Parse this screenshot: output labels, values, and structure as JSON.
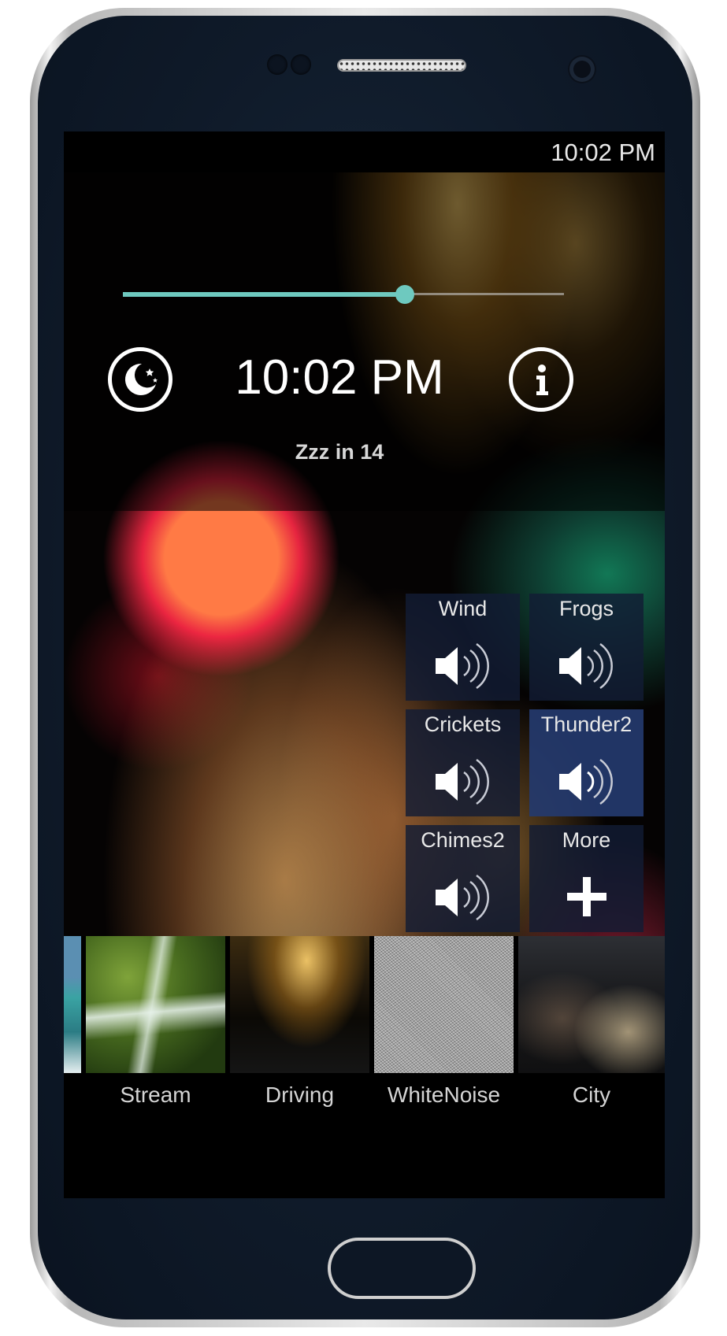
{
  "status_bar": {
    "time": "10:02 PM"
  },
  "player": {
    "volume_level": 0.64,
    "clock": "10:02 PM",
    "sleep_timer_text": "Zzz in 14"
  },
  "sounds": [
    {
      "label": "Wind",
      "icon": "speaker-icon",
      "active": false
    },
    {
      "label": "Frogs",
      "icon": "speaker-icon",
      "active": false
    },
    {
      "label": "Crickets",
      "icon": "speaker-icon",
      "active": false
    },
    {
      "label": "Thunder2",
      "icon": "speaker-icon",
      "active": true
    },
    {
      "label": "Chimes2",
      "icon": "speaker-icon",
      "active": false
    },
    {
      "label": "More",
      "icon": "plus-icon",
      "active": false
    }
  ],
  "scenes": [
    {
      "label": "Stream"
    },
    {
      "label": "Driving"
    },
    {
      "label": "WhiteNoise"
    },
    {
      "label": "City"
    }
  ],
  "colors": {
    "accent": "#6ec9bf",
    "tile_bg": "#121c34",
    "tile_active_bg": "#243a6e"
  }
}
